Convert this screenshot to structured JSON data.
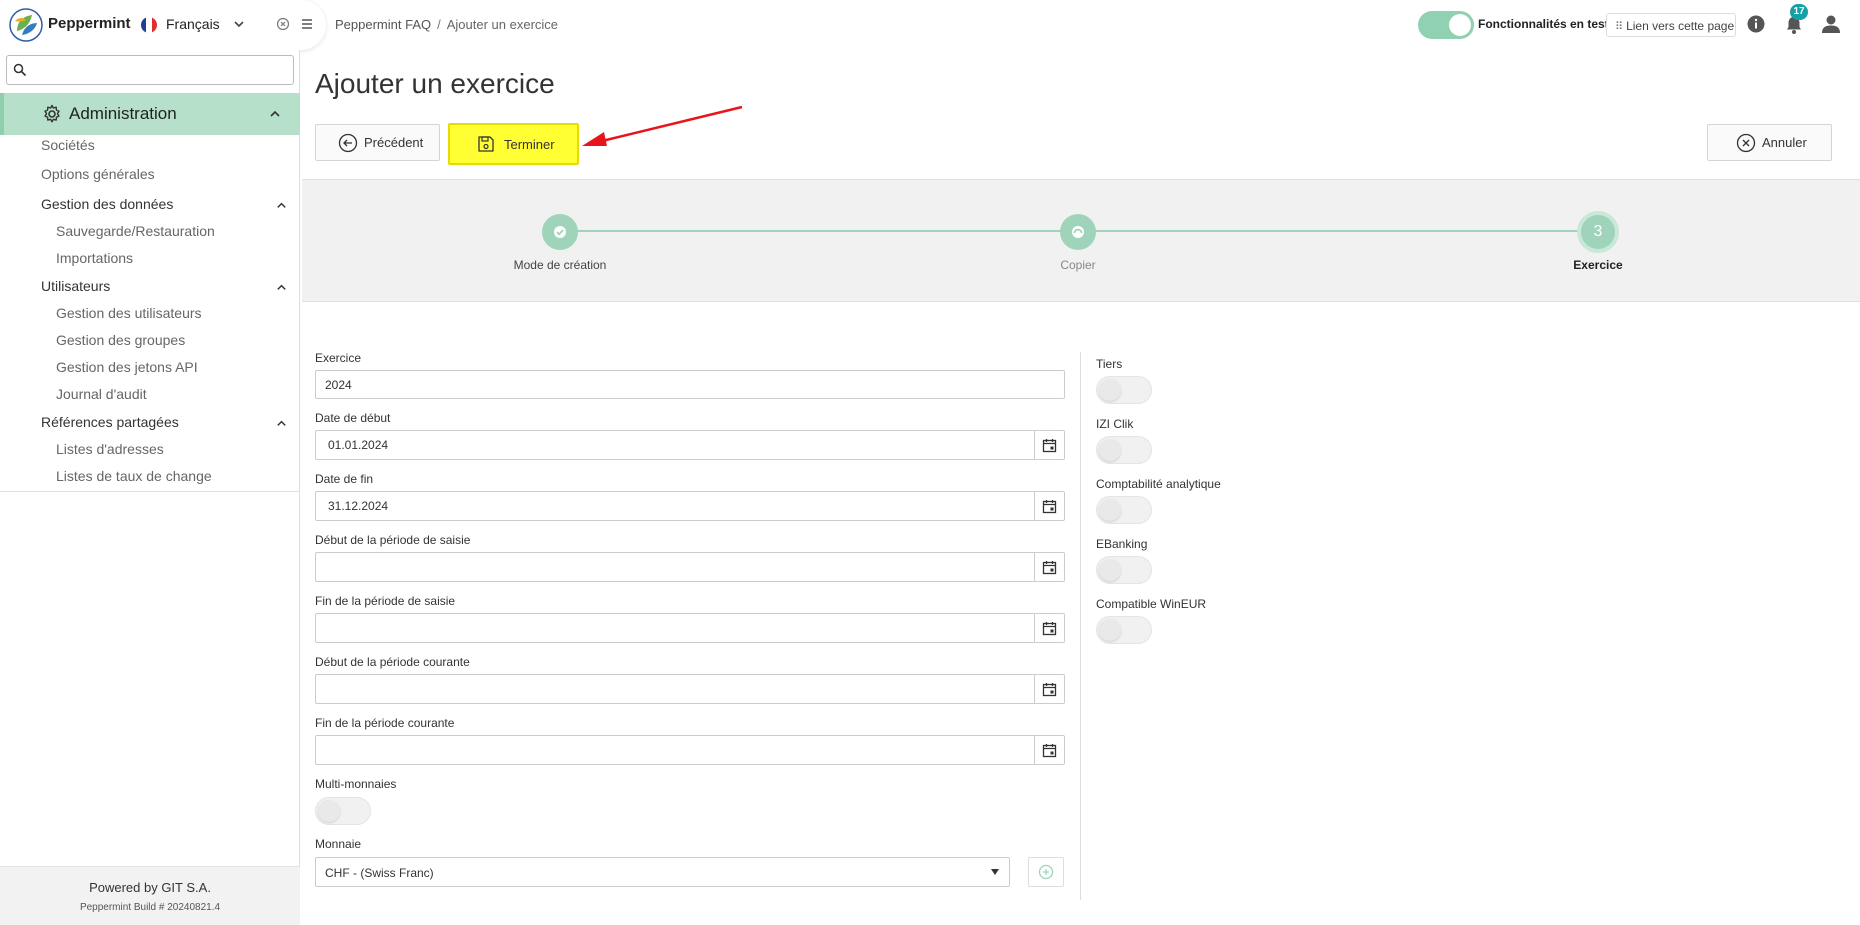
{
  "app": {
    "name": "Peppermint",
    "language": "Français"
  },
  "breadcrumb": {
    "root": "Peppermint FAQ",
    "separator": "/",
    "current": "Ajouter un exercice"
  },
  "topbar": {
    "test_features_label": "Fonctionnalités en test",
    "page_link_label": "Lien vers cette page",
    "notifications_count": "17"
  },
  "sidebar": {
    "search_placeholder": "",
    "section_title": "Administration",
    "items": {
      "societes": "Sociétés",
      "options": "Options générales",
      "gestion_donnees": "Gestion des données",
      "sauvegarde": "Sauvegarde/Restauration",
      "importations": "Importations",
      "utilisateurs": "Utilisateurs",
      "gestion_utilisateurs": "Gestion des utilisateurs",
      "gestion_groupes": "Gestion des groupes",
      "gestion_jetons": "Gestion des jetons API",
      "journal": "Journal d'audit",
      "references": "Références partagées",
      "listes_adresses": "Listes d'adresses",
      "listes_taux": "Listes de taux de change"
    },
    "footer": {
      "powered": "Powered by GIT S.A.",
      "build": "Peppermint Build # 20240821.4"
    }
  },
  "page": {
    "title": "Ajouter un exercice"
  },
  "actions": {
    "previous": "Précédent",
    "finish": "Terminer",
    "cancel": "Annuler"
  },
  "steps": [
    {
      "label": "Mode de création",
      "state": "done"
    },
    {
      "label": "Copier",
      "state": "skipped"
    },
    {
      "label": "Exercice",
      "number": "3",
      "state": "active"
    }
  ],
  "form": {
    "exercice": {
      "label": "Exercice",
      "value": "2024"
    },
    "date_debut": {
      "label": "Date de début",
      "value": "01.01.2024"
    },
    "date_fin": {
      "label": "Date de fin",
      "value": "31.12.2024"
    },
    "debut_saisie": {
      "label": "Début de la période de saisie",
      "value": ""
    },
    "fin_saisie": {
      "label": "Fin de la période de saisie",
      "value": ""
    },
    "debut_courante": {
      "label": "Début de la période courante",
      "value": ""
    },
    "fin_courante": {
      "label": "Fin de la période courante",
      "value": ""
    },
    "multi_monnaies": {
      "label": "Multi-monnaies",
      "on": false
    },
    "monnaie": {
      "label": "Monnaie",
      "value": "CHF - (Swiss Franc)"
    }
  },
  "options": {
    "tiers": {
      "label": "Tiers",
      "on": false
    },
    "izi_clik": {
      "label": "IZI Clik",
      "on": false
    },
    "compta_analytique": {
      "label": "Comptabilité analytique",
      "on": false
    },
    "ebanking": {
      "label": "EBanking",
      "on": false
    },
    "wineur": {
      "label": "Compatible WinEUR",
      "on": false
    }
  },
  "colors": {
    "accent": "#8fd1b0",
    "highlight": "#ffff33",
    "annotation_arrow": "#e8141c",
    "badge": "#15a0a5"
  }
}
